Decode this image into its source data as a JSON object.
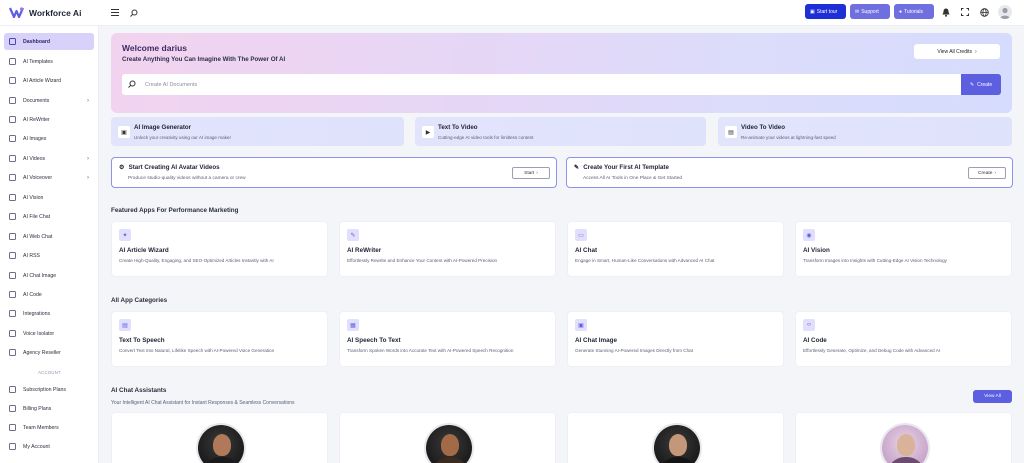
{
  "app": {
    "name": "Workforce Ai"
  },
  "topbar": {
    "buttons": [
      {
        "label": "Start tour",
        "color": "#1f2fd6"
      },
      {
        "label": "Support",
        "color": "#6f6fe0"
      },
      {
        "label": "Tutorials",
        "color": "#6f6fe0"
      }
    ]
  },
  "sidebar": {
    "items": [
      {
        "label": "Dashboard",
        "active": true
      },
      {
        "label": "AI Templates"
      },
      {
        "label": "AI Article Wizard"
      },
      {
        "label": "Documents",
        "chevron": true
      },
      {
        "label": "AI ReWriter"
      },
      {
        "label": "AI Images"
      },
      {
        "label": "AI Videos",
        "chevron": true
      },
      {
        "label": "AI Voiceover",
        "chevron": true
      },
      {
        "label": "AI Vision"
      },
      {
        "label": "AI File Chat"
      },
      {
        "label": "AI Web Chat"
      },
      {
        "label": "AI RSS"
      },
      {
        "label": "AI Chat Image"
      },
      {
        "label": "AI Code"
      },
      {
        "label": "Integrations"
      },
      {
        "label": "Voice Isolator"
      },
      {
        "label": "Agency Reseller"
      }
    ],
    "section_label": "ACCOUNT",
    "account_items": [
      {
        "label": "Subscription Plans"
      },
      {
        "label": "Billing Plans"
      },
      {
        "label": "Team Members"
      },
      {
        "label": "My Account"
      }
    ]
  },
  "hero": {
    "title": "Welcome darius",
    "subtitle": "Create Anything You Can Imagine With The Power Of AI",
    "credits_button": "View All Credits",
    "search_placeholder": "Create AI Documents",
    "create_button": "Create"
  },
  "features": [
    {
      "title": "AI Image Generator",
      "desc": "Unlock your creativity using our AI image maker",
      "icon": "image-icon"
    },
    {
      "title": "Text To Video",
      "desc": "Cutting-edge AI video tools for limitless content",
      "icon": "video-icon"
    },
    {
      "title": "Video To Video",
      "desc": "Re-animate your videos at lightning-fast speed",
      "icon": "film-icon"
    }
  ],
  "promos": [
    {
      "title": "Start Creating AI Avatar Videos",
      "desc": "Produce studio-quality videos without a camera or crew",
      "button": "Start"
    },
    {
      "title": "Create Your First AI Template",
      "desc": "Access All AI Tools in One Place & Get Started",
      "button": "Create"
    }
  ],
  "featured": {
    "heading": "Featured Apps For Performance Marketing",
    "apps": [
      {
        "title": "AI Article Wizard",
        "desc": "Create High-Quality, Engaging, and SEO-Optimized Articles Instantly with AI",
        "icon": "wand-icon"
      },
      {
        "title": "AI ReWriter",
        "desc": "Effortlessly Rewrite and Enhance Your Content with AI-Powered Precision",
        "icon": "pen-icon"
      },
      {
        "title": "AI Chat",
        "desc": "Engage in Smart, Human-Like Conversations with Advanced AI Chat",
        "icon": "chat-icon"
      },
      {
        "title": "AI Vision",
        "desc": "Transform Images into Insights with Cutting-Edge AI Vision Technology",
        "icon": "eye-icon"
      }
    ]
  },
  "categories": {
    "heading": "All App Categories",
    "apps": [
      {
        "title": "Text To Speech",
        "desc": "Convert Text into Natural, Lifelike Speech with AI-Powered Voice Generation",
        "icon": "speaker-icon"
      },
      {
        "title": "AI Speech To Text",
        "desc": "Transform Spoken Words into Accurate Text with AI-Powered Speech Recognition",
        "icon": "mic-icon"
      },
      {
        "title": "AI Chat Image",
        "desc": "Generate Stunning AI-Powered Images Directly from Chat",
        "icon": "image-icon"
      },
      {
        "title": "AI Code",
        "desc": "Effortlessly Generate, Optimize, and Debug Code with Advanced AI",
        "icon": "code-icon"
      }
    ]
  },
  "assistants": {
    "heading": "AI Chat Assistants",
    "subtitle": "Your Intelligent AI Chat Assistant for Instant Responses & Seamless Conversations",
    "view_all": "View All"
  }
}
